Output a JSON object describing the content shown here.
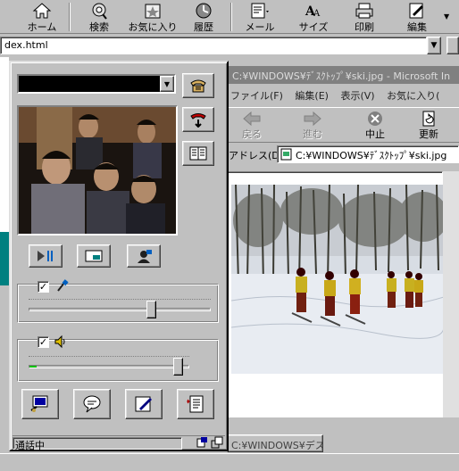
{
  "browser": {
    "toolbar": [
      {
        "label": "ホーム",
        "icon": "home-icon"
      },
      {
        "label": "検索",
        "icon": "search-icon"
      },
      {
        "label": "お気に入り",
        "icon": "favorites-icon"
      },
      {
        "label": "履歴",
        "icon": "history-icon"
      },
      {
        "label": "メール",
        "icon": "mail-icon"
      },
      {
        "label": "サイズ",
        "icon": "font-size-icon"
      },
      {
        "label": "印刷",
        "icon": "print-icon"
      },
      {
        "label": "編集",
        "icon": "edit-icon"
      }
    ],
    "address_value": "dex.html",
    "taskbar_item": "C:¥WINDOWS¥デスク..."
  },
  "ie_window": {
    "title": "C:¥WINDOWS¥ﾃﾞｽｸﾄｯﾌﾟ¥ski.jpg - Microsoft In",
    "menu": [
      "ファイル(F)",
      "編集(E)",
      "表示(V)",
      "お気に入り("
    ],
    "nav": [
      {
        "label": "戻る",
        "icon": "back-arrow-icon",
        "disabled": true
      },
      {
        "label": "進む",
        "icon": "forward-arrow-icon",
        "disabled": true
      },
      {
        "label": "中止",
        "icon": "stop-icon",
        "disabled": false
      },
      {
        "label": "更新",
        "icon": "refresh-icon",
        "disabled": false
      }
    ],
    "address_label": "アドレス(D)",
    "address_value": "C:¥WINDOWS¥ﾃﾞｽｸﾄｯﾌﾟ¥ski.jpg"
  },
  "netmeeting": {
    "status_text": "通話中",
    "mic_enabled": true,
    "speaker_enabled": true,
    "mic_level": 0.67,
    "speaker_level": 0.93,
    "side_buttons": [
      "place-call-icon",
      "hang-up-icon",
      "directory-icon"
    ],
    "video_buttons": [
      "play-pause-icon",
      "picture-in-picture-icon",
      "camera-switch-icon"
    ],
    "bottom_buttons": [
      "share-program-icon",
      "chat-icon",
      "whiteboard-icon",
      "file-transfer-icon"
    ],
    "colors": {
      "panel": "#c0c0c0",
      "video_bg": "#1a1410",
      "accent_green": "#00c000"
    }
  }
}
